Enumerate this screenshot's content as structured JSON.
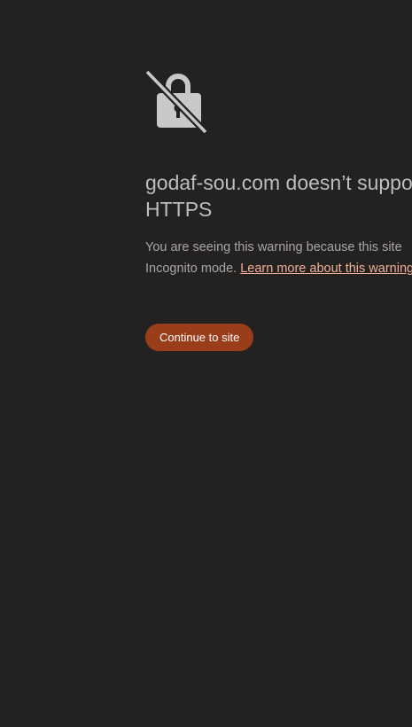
{
  "page": {
    "background_color": "#242121"
  },
  "icon": {
    "name": "unlocked-lock-slash-icon",
    "color": "#c8c8c8"
  },
  "heading": {
    "line1": "godaf-sou.com doesn’t support",
    "line2": "HTTPS"
  },
  "body": {
    "line1": "You are seeing this warning because this site",
    "line2_prefix": "Incognito mode.",
    "link_label": "Learn more about this warning"
  },
  "continue_button": {
    "label": "Continue to site",
    "color": "#9a3d1b"
  }
}
